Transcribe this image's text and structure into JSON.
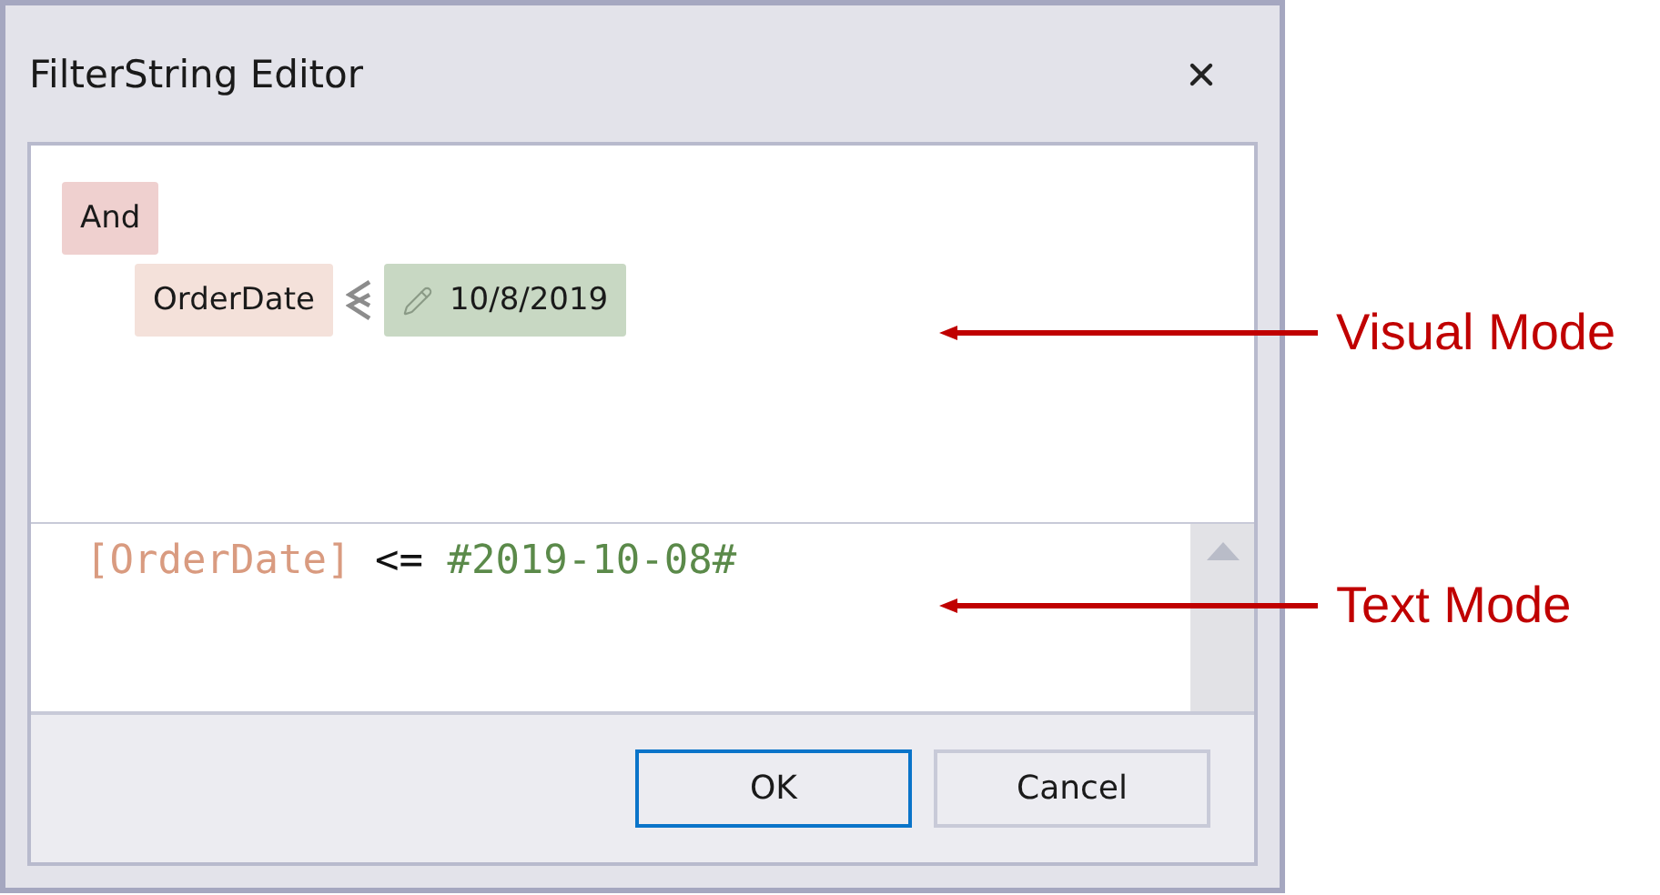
{
  "window": {
    "title": "FilterString Editor"
  },
  "visual_mode": {
    "group": {
      "operator": "And",
      "conditions": [
        {
          "field": "OrderDate",
          "value": "10/8/2019"
        }
      ]
    }
  },
  "text_mode": {
    "tokens": [
      {
        "kind": "field",
        "text": "[OrderDate]"
      },
      {
        "kind": "operator",
        "text": "<="
      },
      {
        "kind": "value",
        "text": "#2019-10-08#"
      }
    ]
  },
  "buttons": [
    {
      "label": "OK",
      "selected": true
    },
    {
      "label": "Cancel",
      "selected": false
    }
  ],
  "annotations": [
    {
      "label": "Visual Mode"
    },
    {
      "label": "Text Mode"
    }
  ]
}
